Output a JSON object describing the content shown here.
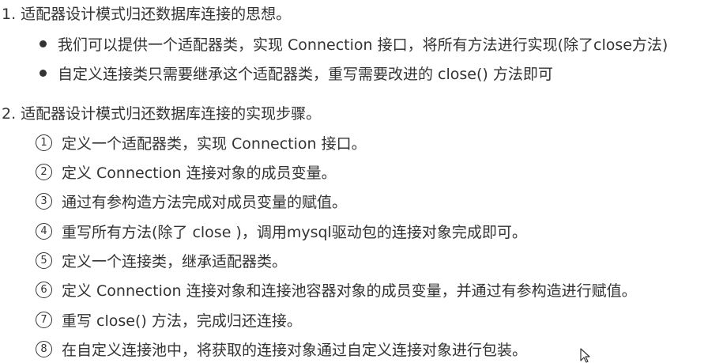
{
  "section1": {
    "title": "1. 适配器设计模式归还数据库连接的思想。",
    "bullets": [
      "我们可以提供一个适配器类，实现 Connection 接口，将所有方法进行实现(除了close方法)",
      "自定义连接类只需要继承这个适配器类，重写需要改进的 close() 方法即可"
    ]
  },
  "section2": {
    "title": "2. 适配器设计模式归还数据库连接的实现步骤。",
    "steps": [
      {
        "num": "1",
        "text": "定义一个适配器类，实现 Connection 接口。"
      },
      {
        "num": "2",
        "text": "定义 Connection 连接对象的成员变量。"
      },
      {
        "num": "3",
        "text": "通过有参构造方法完成对成员变量的赋值。"
      },
      {
        "num": "4",
        "text": "重写所有方法(除了 close )，调用mysql驱动包的连接对象完成即可。"
      },
      {
        "num": "5",
        "text": "定义一个连接类，继承适配器类。"
      },
      {
        "num": "6",
        "text": "定义 Connection 连接对象和连接池容器对象的成员变量，并通过有参构造进行赋值。"
      },
      {
        "num": "7",
        "text": "重写 close() 方法，完成归还连接。"
      },
      {
        "num": "8",
        "text": "在自定义连接池中，将获取的连接对象通过自定义连接对象进行包装。"
      }
    ]
  },
  "icons": {
    "cursor": "mouse-pointer-icon"
  },
  "colors": {
    "text": "#333333",
    "background": "#ffffff"
  }
}
